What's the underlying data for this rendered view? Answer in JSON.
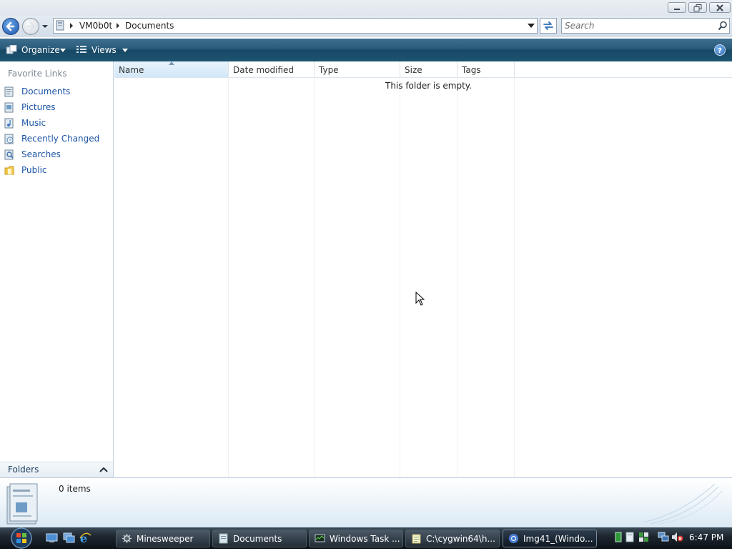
{
  "address": {
    "segments": [
      "VM0b0t",
      "Documents"
    ]
  },
  "search": {
    "placeholder": "Search"
  },
  "toolbar": {
    "organize_label": "Organize",
    "views_label": "Views"
  },
  "nav_pane": {
    "header": "Favorite Links",
    "items": [
      {
        "label": "Documents",
        "icon": "documents-icon"
      },
      {
        "label": "Pictures",
        "icon": "pictures-icon"
      },
      {
        "label": "Music",
        "icon": "music-icon"
      },
      {
        "label": "Recently Changed",
        "icon": "recently-changed-icon"
      },
      {
        "label": "Searches",
        "icon": "searches-icon"
      },
      {
        "label": "Public",
        "icon": "public-folder-icon"
      }
    ],
    "folders_label": "Folders"
  },
  "file_list": {
    "columns": [
      "Name",
      "Date modified",
      "Type",
      "Size",
      "Tags"
    ],
    "sorted_column": "Name",
    "empty_message": "This folder is empty."
  },
  "details_pane": {
    "item_count": "0 items"
  },
  "taskbar": {
    "buttons": [
      {
        "label": "Minesweeper",
        "icon": "minesweeper-icon"
      },
      {
        "label": "Documents",
        "icon": "folder-icon"
      },
      {
        "label": "Windows Task ...",
        "icon": "task-manager-icon"
      },
      {
        "label": "C:\\cygwin64\\h...",
        "icon": "notepad-icon"
      },
      {
        "label": "Img41_(Windo...",
        "icon": "chrome-icon"
      }
    ],
    "active_button": "Img41_(Windo...",
    "clock": "6:47 PM"
  },
  "colors": {
    "link": "#1b55a5",
    "toolbar": "#1d5471",
    "taskbar": "#1e2730"
  }
}
